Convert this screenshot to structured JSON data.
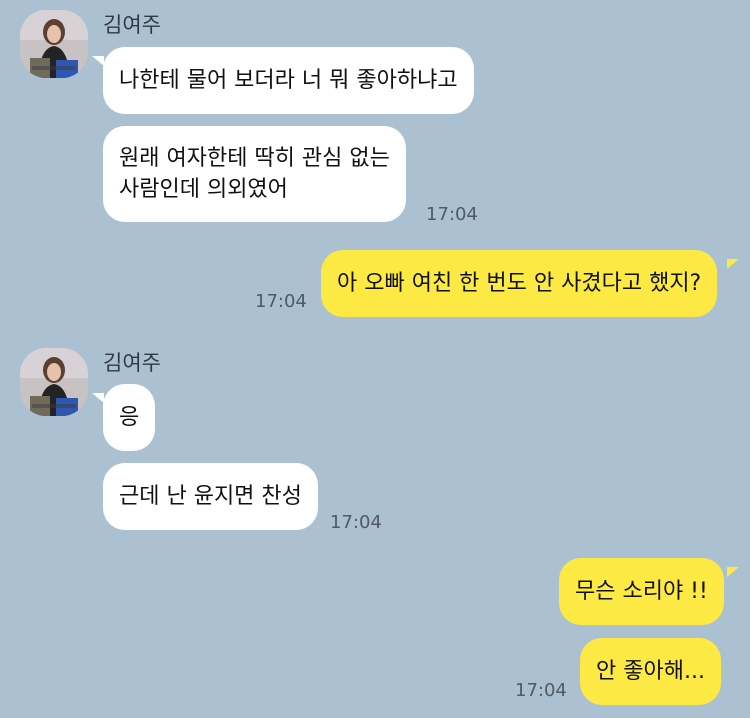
{
  "messages": [
    {
      "sender": "김여주",
      "text": "나한테 물어 보더라 너 뭐 좋아하냐고"
    },
    {
      "text_lines": [
        "원래 여자한테 딱히 관심 없는",
        "사람인데 의외였어"
      ],
      "time": "17:04"
    },
    {
      "text": "아 오빠 여친 한 번도 안 사겼다고 했지?",
      "time": "17:04"
    },
    {
      "sender": "김여주",
      "text": "응"
    },
    {
      "text": "근데 난 윤지면 찬성",
      "time": "17:04"
    },
    {
      "text": "무슨 소리야 !!"
    },
    {
      "text": "안 좋아해...",
      "time": "17:04"
    }
  ],
  "colors": {
    "background": "#abc1d1",
    "incoming_bubble": "#ffffff",
    "outgoing_bubble": "#fce943"
  },
  "icons": {
    "avatar": "profile-photo"
  }
}
